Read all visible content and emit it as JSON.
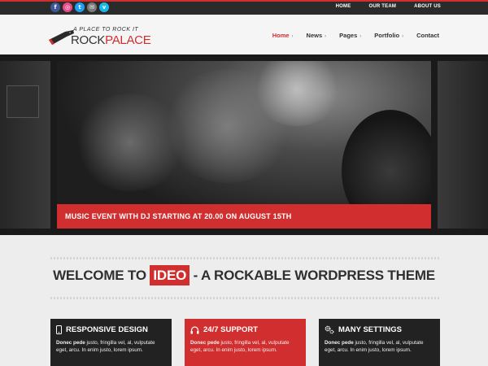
{
  "topbar": {
    "social": [
      {
        "icon": "facebook-icon",
        "glyph": "f",
        "color": "#3b5998"
      },
      {
        "icon": "dribbble-icon",
        "glyph": "◎",
        "color": "#ea4c89"
      },
      {
        "icon": "twitter-icon",
        "glyph": "t",
        "color": "#1da1f2"
      },
      {
        "icon": "email-icon",
        "glyph": "✉",
        "color": "#7a7a7a"
      },
      {
        "icon": "vimeo-icon",
        "glyph": "v",
        "color": "#1ab7ea"
      }
    ],
    "nav": [
      "HOME",
      "OUR TEAM",
      "ABOUT US"
    ]
  },
  "header": {
    "logo": {
      "tagline": "A PLACE TO ROCK IT",
      "name_part1": "ROCK",
      "name_part2": "PALACE"
    },
    "nav": [
      {
        "label": "Home",
        "active": true,
        "chevron": "›"
      },
      {
        "label": "News",
        "active": false,
        "chevron": "›"
      },
      {
        "label": "Pages",
        "active": false,
        "chevron": "›"
      },
      {
        "label": "Portfolio",
        "active": false,
        "chevron": "›"
      },
      {
        "label": "Contact",
        "active": false,
        "chevron": ""
      }
    ]
  },
  "slider": {
    "caption": "MUSIC EVENT WITH DJ STARTING AT 20.00 ON AUGUST 15TH"
  },
  "welcome": {
    "headline_before": "WELCOME TO ",
    "headline_highlight": "IDEO",
    "headline_after": " - A ROCKABLE WORDPRESS THEME"
  },
  "features": [
    {
      "title": "RESPONSIVE DESIGN",
      "icon": "mobile-icon",
      "bold": "Donec pede",
      "text": " justo, fringilla vel, al, vulputate eget, arcu. In enim justo, lorem ipsum."
    },
    {
      "title": "24/7 SUPPORT",
      "icon": "headphones-icon",
      "bold": "Donec pede",
      "text": " justo, fringilla vel, al, vulputate eget, arcu. In enim justo, lorem ipsum."
    },
    {
      "title": "MANY SETTINGS",
      "icon": "gears-icon",
      "bold": "Donec pede",
      "text": " justo, fringilla vel, al, vulputate eget, arcu. In enim justo, lorem ipsum."
    }
  ],
  "colors": {
    "accent": "#d12f2f",
    "dark": "#222222"
  }
}
